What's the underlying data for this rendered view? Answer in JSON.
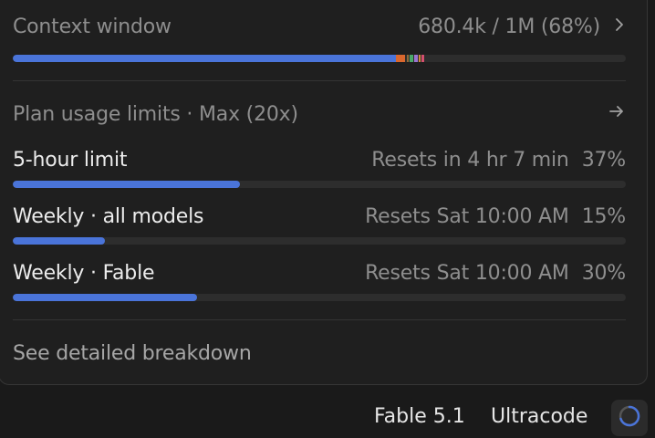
{
  "context": {
    "title": "Context window",
    "usage": "680.4k / 1M (68%)",
    "fill_fraction": 0.625,
    "segments": [
      {
        "color": "#d9672e",
        "fraction": 0.015
      },
      {
        "color": "#8f6a3a",
        "fraction": 0.003
      },
      {
        "color": "#4aa86a",
        "fraction": 0.006
      },
      {
        "color": "#9b74d1",
        "fraction": 0.005
      },
      {
        "color": "#d38a3c",
        "fraction": 0.004
      },
      {
        "color": "#d44f6e",
        "fraction": 0.004
      }
    ]
  },
  "plan": {
    "title": "Plan usage limits · Max (20x)",
    "limits": [
      {
        "label": "5-hour limit",
        "reset": "Resets in 4 hr 7 min",
        "percent": "37%",
        "fraction": 0.37
      },
      {
        "label": "Weekly · all models",
        "reset": "Resets Sat 10:00 AM",
        "percent": "15%",
        "fraction": 0.15
      },
      {
        "label": "Weekly · Fable",
        "reset": "Resets Sat 10:00 AM",
        "percent": "30%",
        "fraction": 0.3
      }
    ]
  },
  "breakdown_label": "See detailed breakdown",
  "footer": {
    "model": "Fable 5.1",
    "mode": "Ultracode"
  },
  "icons": {
    "context_chevron": "chevron-right-icon",
    "plan_arrow": "arrow-right-icon",
    "status": "spinner-icon"
  },
  "colors": {
    "accent": "#4a74d9"
  }
}
